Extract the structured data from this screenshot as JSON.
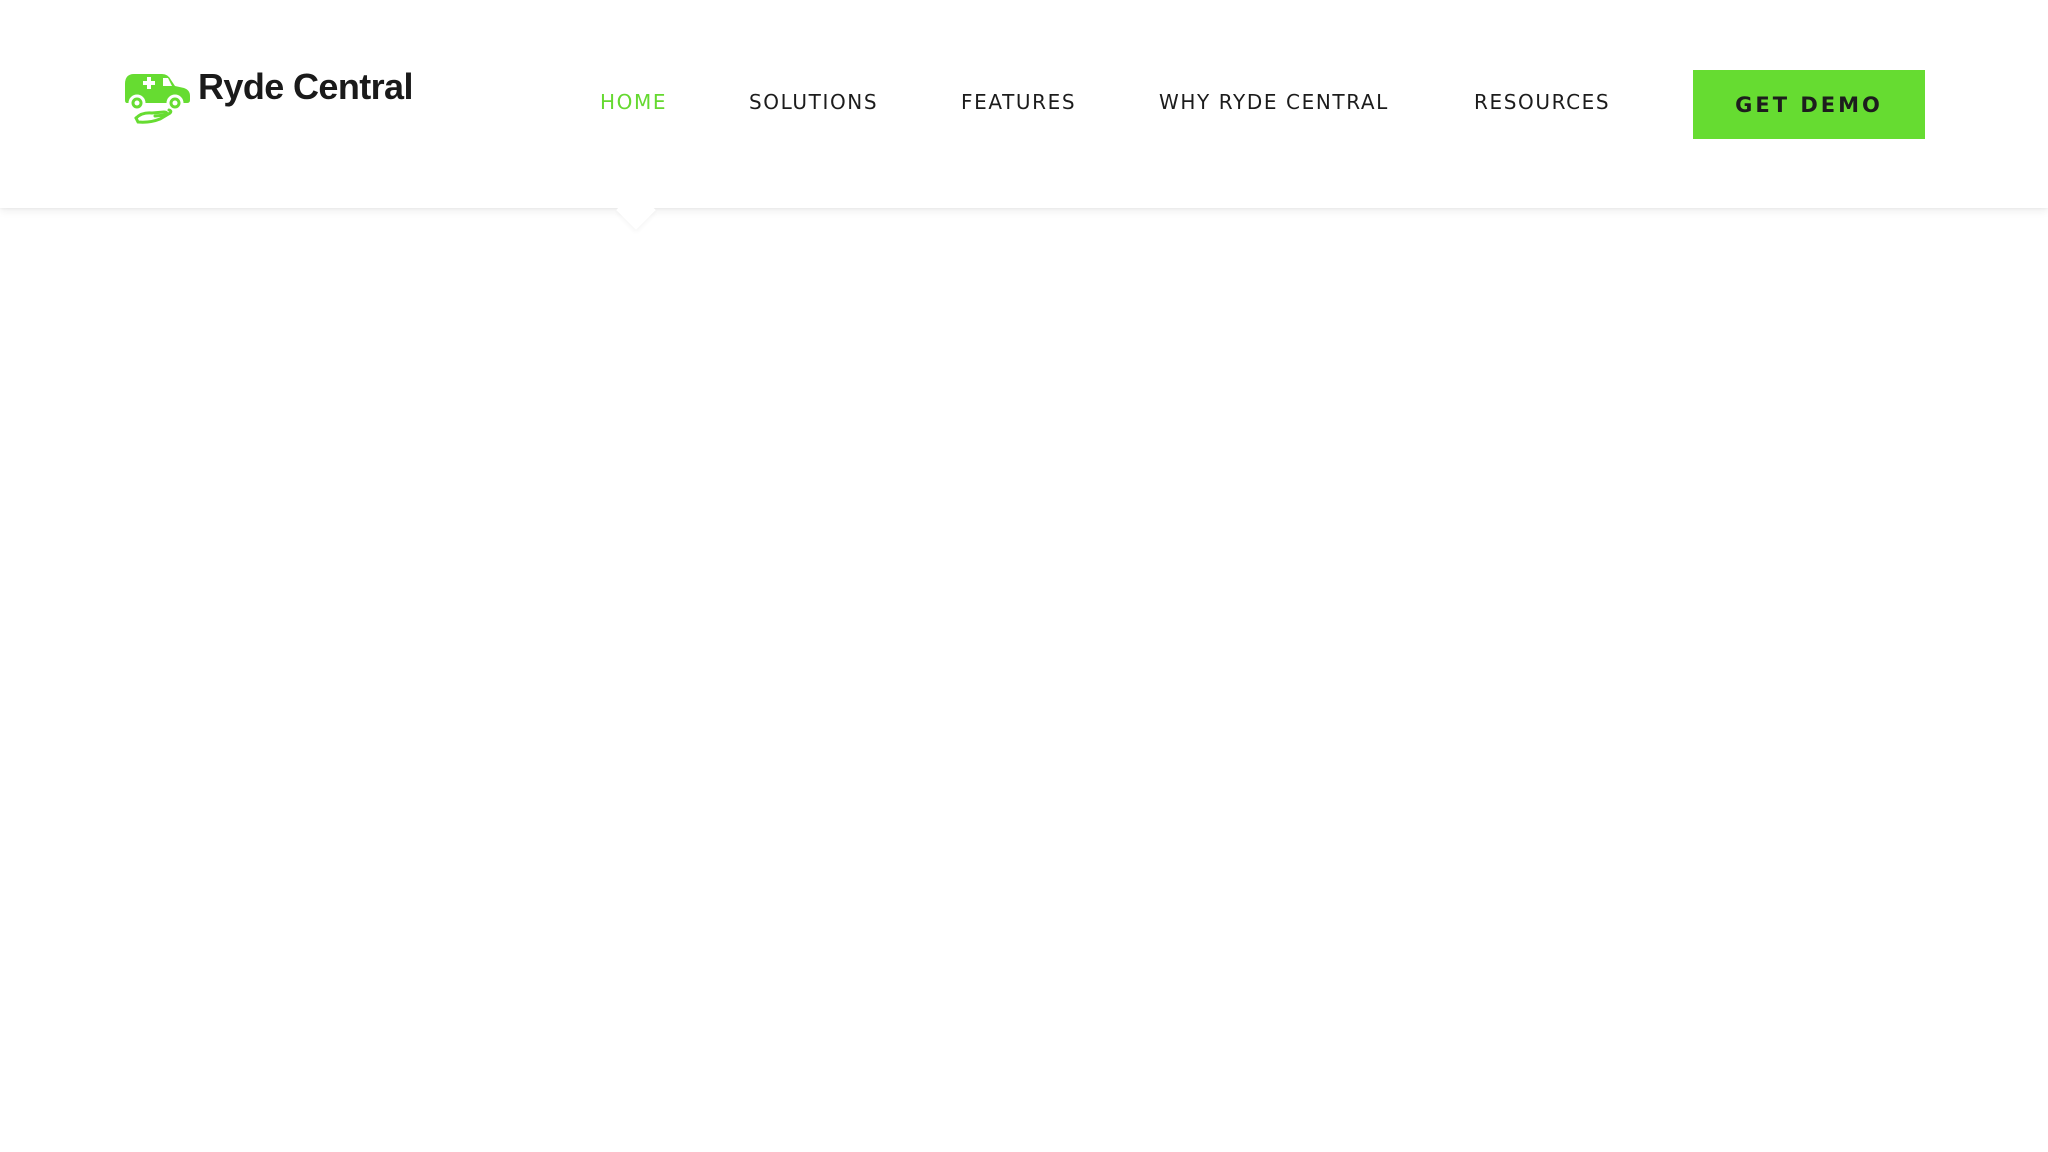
{
  "brand": {
    "name": "Ryde Central",
    "logo_icon": "car-with-hand-icon",
    "accent_color": "#66dc31"
  },
  "nav": {
    "items": [
      {
        "label": "HOME",
        "active": true
      },
      {
        "label": "SOLUTIONS",
        "active": false
      },
      {
        "label": "FEATURES",
        "active": false
      },
      {
        "label": "WHY RYDE CENTRAL",
        "active": false
      },
      {
        "label": "RESOURCES",
        "active": false
      }
    ],
    "active_color": "#65d930",
    "text_color": "#1c1c1c"
  },
  "cta": {
    "label": "GET DEMO"
  }
}
